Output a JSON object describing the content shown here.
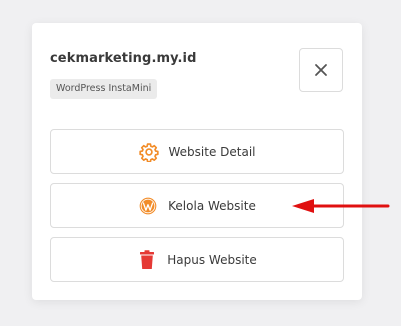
{
  "card": {
    "site_name": "cekmarketing.my.id",
    "badge": "WordPress InstaMini"
  },
  "buttons": {
    "detail_label": "Website Detail",
    "kelola_label": "Kelola Website",
    "hapus_label": "Hapus Website"
  },
  "icons": {
    "close": "close-icon",
    "detail": "gear-icon",
    "kelola": "wordpress-icon",
    "hapus": "trash-icon",
    "annotation": "arrow-left-icon"
  },
  "colors": {
    "gear": "#f28c28",
    "wordpress": "#f28c28",
    "trash": "#e53935",
    "arrow": "#e01010"
  }
}
